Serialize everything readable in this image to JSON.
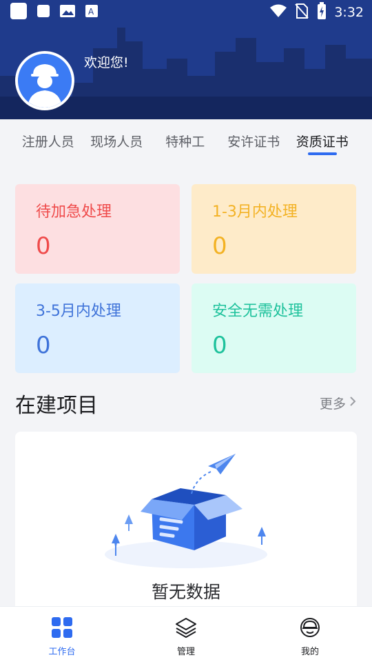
{
  "status_bar": {
    "time": "3:32",
    "left_icons": [
      "app-square-icon",
      "notification-square-icon",
      "image-icon",
      "text-a-icon"
    ],
    "right_icons": [
      "wifi-icon",
      "no-sim-icon",
      "battery-charging-icon"
    ]
  },
  "header": {
    "welcome": "欢迎您!",
    "avatar_icon": "worker-avatar-icon"
  },
  "tabs": [
    {
      "label": "注册人员"
    },
    {
      "label": "现场人员"
    },
    {
      "label": "特种工"
    },
    {
      "label": "安许证书"
    },
    {
      "label": "资质证书"
    }
  ],
  "active_tab": "资质证书",
  "stat_cards": [
    {
      "title": "待加急处理",
      "value": "0",
      "color": "#ef4b4b"
    },
    {
      "title": "1-3月内处理",
      "value": "0",
      "color": "#f3b224"
    },
    {
      "title": "3-5月内处理",
      "value": "0",
      "color": "#3f73d9"
    },
    {
      "title": "安全无需处理",
      "value": "0",
      "color": "#1fc29c"
    }
  ],
  "projects": {
    "title": "在建项目",
    "more_label": "更多",
    "empty_text": "暂无数据"
  },
  "bottom_nav": [
    {
      "label": "工作台",
      "icon": "grid-icon"
    },
    {
      "label": "管理",
      "icon": "layers-icon"
    },
    {
      "label": "我的",
      "icon": "helmet-icon"
    }
  ],
  "colors": {
    "header_bg": "#1e3a8a",
    "accent": "#2e6bf0"
  }
}
